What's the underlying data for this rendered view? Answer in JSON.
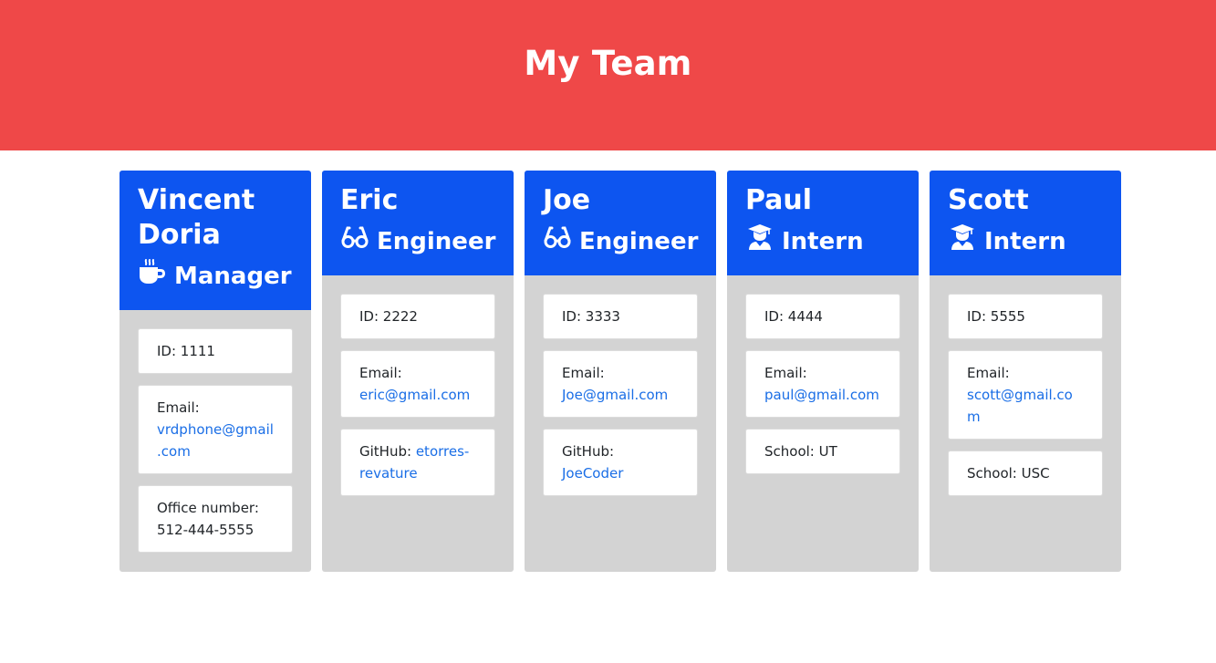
{
  "header": {
    "title": "My Team"
  },
  "team": [
    {
      "name": "Vincent Doria",
      "role": "Manager",
      "icon": "coffee-icon",
      "id_label": "ID: 1111",
      "email_label": "Email:",
      "email": "vrdphone@gmail.com",
      "extra_label": "Office number:",
      "extra_value": "512-444-5555"
    },
    {
      "name": "Eric",
      "role": "Engineer",
      "icon": "glasses-icon",
      "id_label": "ID: 2222",
      "email_label": "Email:",
      "email": "eric@gmail.com",
      "extra_label": "GitHub:",
      "extra_value": "etorres-revature"
    },
    {
      "name": "Joe",
      "role": "Engineer",
      "icon": "glasses-icon",
      "id_label": "ID: 3333",
      "email_label": "Email:",
      "email": "Joe@gmail.com",
      "extra_label": "GitHub:",
      "extra_value": "JoeCoder"
    },
    {
      "name": "Paul",
      "role": "Intern",
      "icon": "graduate-icon",
      "id_label": "ID: 4444",
      "email_label": "Email:",
      "email": "paul@gmail.com",
      "extra_label": "School:",
      "extra_value": "UT"
    },
    {
      "name": "Scott",
      "role": "Intern",
      "icon": "graduate-icon",
      "id_label": "ID: 5555",
      "email_label": "Email:",
      "email": "scott@gmail.com",
      "extra_label": "School:",
      "extra_value": "USC"
    }
  ],
  "colors": {
    "header_bg": "#ef4848",
    "card_header_bg": "#0d55f0",
    "card_body_bg": "#d3d3d3",
    "link": "#1a6ee6"
  }
}
